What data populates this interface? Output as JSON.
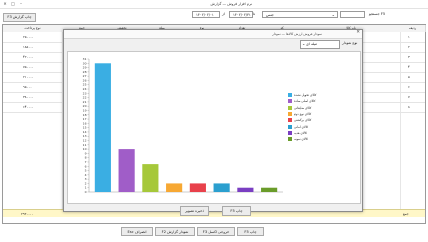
{
  "window": {
    "title": "نرم افزار فروش — گزارش"
  },
  "toolbar": {
    "print_report_label": "F3 چاپ گزارش",
    "date_label": "از",
    "date_from": "۱۴۰۲/۰۲/۰۱",
    "date_to_label": "تا",
    "date_to": "۱۴۰۲/۰۲/۳۱",
    "search_label": "جستجو F5",
    "search_type": "جنس"
  },
  "grid": {
    "columns": [
      "ردیف",
      "نام کالا",
      "کد",
      "تعداد",
      "نوع",
      "مبلغ",
      "تخفیف",
      "جمع",
      "نوع پرداخت"
    ],
    "row_numbers": [
      "۱",
      "۲",
      "۳",
      "۴",
      "۵",
      "۶",
      "۷",
      "۸"
    ],
    "payment_values": [
      "۲۵۰۰۰۰",
      "۱۸۵۰۰۰",
      "۴۲۰۰۰۰",
      "۷۵۰۰۰۰",
      "۲۱۰۰۰۰",
      "۹۵۰۰۰",
      "۳۸۰۰۰۰",
      "۶۴۰۰۰۰"
    ],
    "total_row": {
      "label": "جمع",
      "value": "۲۹۳۰۰۰۰"
    }
  },
  "dialog": {
    "title": "نمودار فروش ارزش کالاها — نمودار",
    "chart_type_label": "نوع نمودار",
    "chart_type_value": "میله ای",
    "save_button": "ذخیره تصویر",
    "print_button": "F5 چاپ"
  },
  "chart_data": {
    "type": "bar",
    "categories": [
      "کالای تحویل نشده",
      "کالای اصلی ساده",
      "کالای ضایعاتی",
      "کالای نوع دوم",
      "کالای برگشتی",
      "کالای امانی",
      "کالای هدیه",
      "کالای نمونه"
    ],
    "values": [
      30,
      10,
      6.5,
      2,
      2,
      2,
      1,
      1
    ],
    "colors": [
      "#3aaee3",
      "#a05dc8",
      "#a6c83a",
      "#f7a833",
      "#e8414b",
      "#2b9fcf",
      "#7a3ec2",
      "#6a9c2a"
    ],
    "ylim": [
      0,
      31
    ],
    "yticks": [
      0,
      1,
      2,
      3,
      4,
      5,
      6,
      7,
      8,
      9,
      10,
      11,
      12,
      13,
      14,
      15,
      16,
      17,
      18,
      19,
      20,
      21,
      22,
      23,
      24,
      25,
      26,
      27,
      28,
      29,
      30,
      31
    ],
    "grid": false,
    "legend": "right"
  },
  "footer": {
    "buttons": [
      "F5 چاپ",
      "F3 خروجی اکسل",
      "F2 نمودار گزارش",
      "Esc انصراف"
    ]
  }
}
